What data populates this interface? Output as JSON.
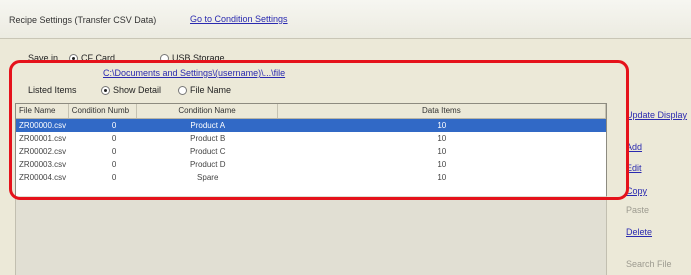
{
  "window": {
    "title": "Recipe Settings (Transfer CSV Data)",
    "condition_link": "Go to Condition Settings"
  },
  "save_in": {
    "label": "Save in",
    "options": [
      "CF Card",
      "USB Storage"
    ],
    "selected": "CF Card"
  },
  "folder_path": "C:\\Documents and Settings\\(username)\\...\\file",
  "listed_items": {
    "label": "Listed Items",
    "options": [
      "Show Detail",
      "File Name"
    ],
    "selected": "Show Detail"
  },
  "table": {
    "columns": [
      "File Name",
      "Condition Numb",
      "Condition Name",
      "Data Items"
    ],
    "rows": [
      [
        "ZR00000.csv",
        "0",
        "Product A",
        "10"
      ],
      [
        "ZR00001.csv",
        "0",
        "Product B",
        "10"
      ],
      [
        "ZR00002.csv",
        "0",
        "Product C",
        "10"
      ],
      [
        "ZR00003.csv",
        "0",
        "Product D",
        "10"
      ],
      [
        "ZR00004.csv",
        "0",
        "Spare",
        "10"
      ]
    ],
    "selected_row": 0
  },
  "actions": {
    "update_display": "Update Display",
    "add": "Add",
    "edit": "Edit",
    "copy": "Copy",
    "paste": "Paste",
    "delete": "Delete",
    "search_file": "Search File"
  },
  "colors": {
    "highlight": "#e5121b",
    "selection": "#3169c6",
    "link": "#2a2ab0"
  }
}
